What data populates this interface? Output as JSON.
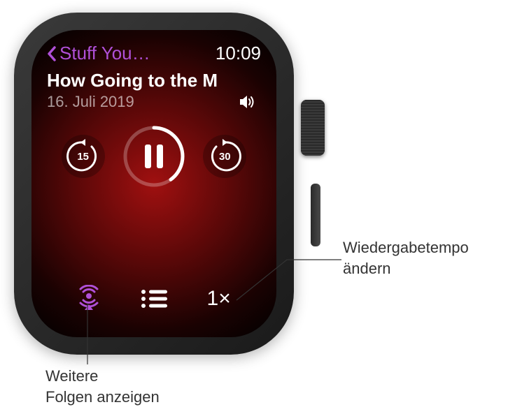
{
  "header": {
    "back_label": "Stuff You…",
    "time": "10:09"
  },
  "episode": {
    "title": "How Going to the M",
    "date": "16. Juli 2019"
  },
  "controls": {
    "skip_back_seconds": "15",
    "skip_forward_seconds": "30",
    "playback_speed": "1×"
  },
  "callouts": {
    "speed": "Wiedergabetempo ändern",
    "episodes": "Weitere Folgen anzeigen"
  },
  "colors": {
    "accent": "#b050d8"
  }
}
